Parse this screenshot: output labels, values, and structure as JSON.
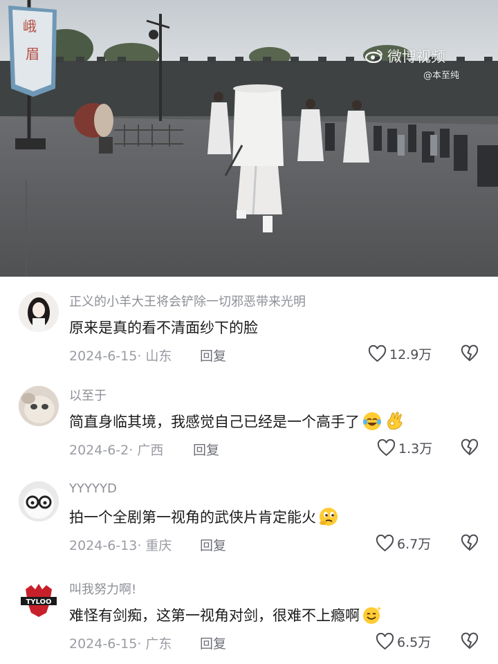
{
  "watermark": {
    "platform": "微博视频",
    "user": "@本至纯"
  },
  "banner_text": [
    "峨",
    "眉"
  ],
  "comments": [
    {
      "username": "正义的小羊大王将会铲除一切邪恶带来光明",
      "text": "原来是真的看不清面纱下的脸",
      "emojis": [],
      "date_location": "2024-6-15· 山东",
      "reply_label": "回复",
      "likes": "12.9万"
    },
    {
      "username": "以至于",
      "text": "简直身临其境，我感觉自己已经是一个高手了",
      "emojis": [
        "laughing-crying-emoji",
        "ok-hand-emoji"
      ],
      "date_location": "2024-6-2· 广西",
      "reply_label": "回复",
      "likes": "1.3万"
    },
    {
      "username": "YYYYYD",
      "text": "拍一个全剧第一视角的武侠片肯定能火",
      "emojis": [
        "thinking-emoji"
      ],
      "date_location": "2024-6-13· 重庆",
      "reply_label": "回复",
      "likes": "6.7万"
    },
    {
      "username": "叫我努力啊!",
      "text": "难怪有剑痴，这第一视角对剑，很难不上瘾啊",
      "emojis": [
        "sparkle-smile-emoji"
      ],
      "date_location": "2024-6-15· 广东",
      "reply_label": "回复",
      "likes": "6.5万"
    }
  ],
  "avatar_logo_text": "TYLOO",
  "icons": {
    "like": "heart-icon",
    "dislike": "broken-heart-icon"
  },
  "colors": {
    "username": "#8d8f96",
    "body_text": "#1b1b1b",
    "meta": "#9a9ca3",
    "video_sky": "#c9ced3",
    "video_ground": "#5e6062"
  }
}
